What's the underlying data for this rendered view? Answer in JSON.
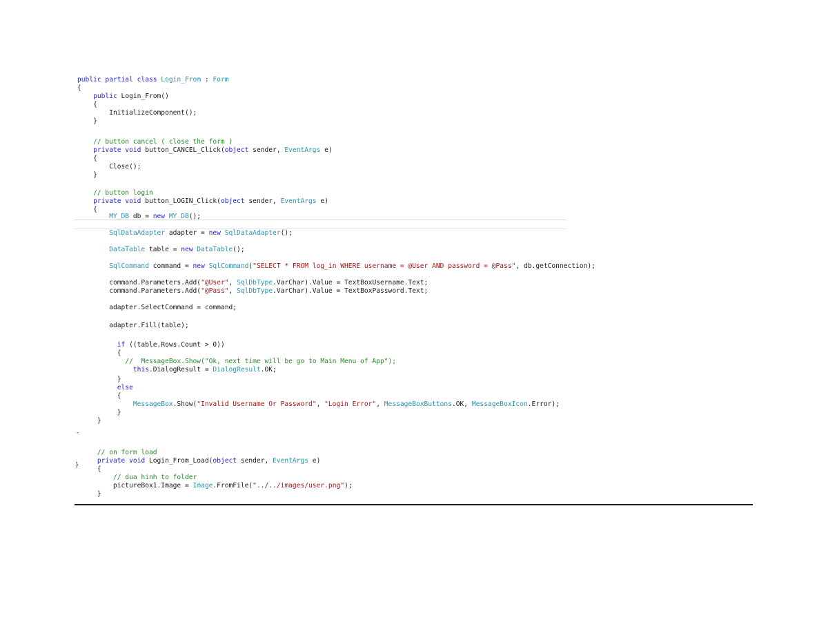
{
  "document": {
    "code_lines": [
      [
        {
          "t": "public partial class ",
          "c": "kw"
        },
        {
          "t": "Login_From",
          "c": "ty"
        },
        {
          "t": " : ",
          "c": "tx"
        },
        {
          "t": "Form",
          "c": "ty"
        }
      ],
      [
        {
          "t": "{",
          "c": "tx"
        }
      ],
      [
        {
          "t": "    public ",
          "c": "kw"
        },
        {
          "t": "Login_From()",
          "c": "tx"
        }
      ],
      [
        {
          "t": "    {",
          "c": "tx"
        }
      ],
      [
        {
          "t": "        InitializeComponent();",
          "c": "tx"
        }
      ],
      [
        {
          "t": "    }",
          "c": "tx"
        }
      ],
      [
        {
          "t": "",
          "c": "tx"
        }
      ],
      [
        {
          "t": "    // button cancel ( close the form )",
          "c": "cm"
        }
      ],
      [
        {
          "t": "    private void ",
          "c": "kw"
        },
        {
          "t": "button_CANCEL_Click(",
          "c": "tx"
        },
        {
          "t": "object",
          "c": "kw"
        },
        {
          "t": " sender, ",
          "c": "tx"
        },
        {
          "t": "EventArgs",
          "c": "ty"
        },
        {
          "t": " e)",
          "c": "tx"
        }
      ],
      [
        {
          "t": "    {",
          "c": "tx"
        }
      ],
      [
        {
          "t": "        Close();",
          "c": "tx"
        }
      ],
      [
        {
          "t": "    }",
          "c": "tx"
        }
      ],
      [
        {
          "t": "",
          "c": "tx"
        }
      ],
      [
        {
          "t": "    // button login",
          "c": "cm"
        }
      ],
      [
        {
          "t": "    private void ",
          "c": "kw"
        },
        {
          "t": "button_LOGIN_Click(",
          "c": "tx"
        },
        {
          "t": "object",
          "c": "kw"
        },
        {
          "t": " sender, ",
          "c": "tx"
        },
        {
          "t": "EventArgs",
          "c": "ty"
        },
        {
          "t": " e)",
          "c": "tx"
        }
      ],
      [
        {
          "t": "    {",
          "c": "tx"
        }
      ],
      [
        {
          "t": "        MY_DB",
          "c": "ty"
        },
        {
          "t": " db = ",
          "c": "tx"
        },
        {
          "t": "new ",
          "c": "kw"
        },
        {
          "t": "MY_DB",
          "c": "ty"
        },
        {
          "t": "();",
          "c": "tx"
        }
      ],
      [
        {
          "t": "",
          "c": "tx"
        }
      ],
      [
        {
          "t": "        SqlDataAdapter",
          "c": "ty"
        },
        {
          "t": " adapter = ",
          "c": "tx"
        },
        {
          "t": "new ",
          "c": "kw"
        },
        {
          "t": "SqlDataAdapter",
          "c": "ty"
        },
        {
          "t": "();",
          "c": "tx"
        }
      ],
      [
        {
          "t": "",
          "c": "tx"
        }
      ],
      [
        {
          "t": "        DataTable",
          "c": "ty"
        },
        {
          "t": " table = ",
          "c": "tx"
        },
        {
          "t": "new ",
          "c": "kw"
        },
        {
          "t": "DataTable",
          "c": "ty"
        },
        {
          "t": "();",
          "c": "tx"
        }
      ],
      [
        {
          "t": "",
          "c": "tx"
        }
      ],
      [
        {
          "t": "        SqlCommand",
          "c": "ty"
        },
        {
          "t": " command = ",
          "c": "tx"
        },
        {
          "t": "new ",
          "c": "kw"
        },
        {
          "t": "SqlCommand",
          "c": "ty"
        },
        {
          "t": "(",
          "c": "tx"
        },
        {
          "t": "\"SELECT * FROM log_in WHERE username = @User AND password = @Pass\"",
          "c": "st"
        },
        {
          "t": ", db.getConnection);",
          "c": "tx"
        }
      ],
      [
        {
          "t": "",
          "c": "tx"
        }
      ],
      [
        {
          "t": "        command.Parameters.Add(",
          "c": "tx"
        },
        {
          "t": "\"@User\"",
          "c": "st"
        },
        {
          "t": ", ",
          "c": "tx"
        },
        {
          "t": "SqlDbType",
          "c": "ty"
        },
        {
          "t": ".VarChar).Value = TextBoxUsername.Text;",
          "c": "tx"
        }
      ],
      [
        {
          "t": "        command.Parameters.Add(",
          "c": "tx"
        },
        {
          "t": "\"@Pass\"",
          "c": "st"
        },
        {
          "t": ", ",
          "c": "tx"
        },
        {
          "t": "SqlDbType",
          "c": "ty"
        },
        {
          "t": ".VarChar).Value = TextBoxPassword.Text;",
          "c": "tx"
        }
      ],
      [
        {
          "t": "",
          "c": "tx"
        }
      ],
      [
        {
          "t": "        adapter.SelectCommand = command;",
          "c": "tx"
        }
      ],
      [
        {
          "t": "",
          "c": "tx"
        }
      ],
      [
        {
          "t": "        adapter.Fill(table);",
          "c": "tx"
        }
      ],
      [
        {
          "t": "",
          "c": "tx"
        }
      ],
      [
        {
          "t": "",
          "c": "tx"
        }
      ],
      [
        {
          "t": "          if ",
          "c": "kw"
        },
        {
          "t": "((table.Rows.Count > 0))",
          "c": "tx"
        }
      ],
      [
        {
          "t": "          {",
          "c": "tx"
        }
      ],
      [
        {
          "t": "            //  MessageBox.Show(\"Ok, next time will be go to Main Menu of App\");",
          "c": "cm"
        }
      ],
      [
        {
          "t": "              this",
          "c": "kw"
        },
        {
          "t": ".DialogResult = ",
          "c": "tx"
        },
        {
          "t": "DialogResult",
          "c": "ty"
        },
        {
          "t": ".OK;",
          "c": "tx"
        }
      ],
      [
        {
          "t": "          }",
          "c": "tx"
        }
      ],
      [
        {
          "t": "          else",
          "c": "kw"
        }
      ],
      [
        {
          "t": "          {",
          "c": "tx"
        }
      ],
      [
        {
          "t": "              MessageBox",
          "c": "ty"
        },
        {
          "t": ".Show(",
          "c": "tx"
        },
        {
          "t": "\"Invalid Username Or Password\"",
          "c": "st"
        },
        {
          "t": ", ",
          "c": "tx"
        },
        {
          "t": "\"Login Error\"",
          "c": "st"
        },
        {
          "t": ", ",
          "c": "tx"
        },
        {
          "t": "MessageBoxButtons",
          "c": "ty"
        },
        {
          "t": ".OK, ",
          "c": "tx"
        },
        {
          "t": "MessageBoxIcon",
          "c": "ty"
        },
        {
          "t": ".Error);",
          "c": "tx"
        }
      ],
      [
        {
          "t": "          }",
          "c": "tx"
        }
      ],
      [
        {
          "t": "     }",
          "c": "tx"
        }
      ],
      [
        {
          "t": "",
          "c": "tx"
        }
      ],
      [
        {
          "t": "",
          "c": "tx"
        }
      ],
      [
        {
          "t": "     // on form load",
          "c": "cm"
        }
      ],
      [
        {
          "t": "     private void ",
          "c": "kw"
        },
        {
          "t": "Login_From_Load(",
          "c": "tx"
        },
        {
          "t": "object",
          "c": "kw"
        },
        {
          "t": " sender, ",
          "c": "tx"
        },
        {
          "t": "EventArgs",
          "c": "ty"
        },
        {
          "t": " e)",
          "c": "tx"
        }
      ],
      [
        {
          "t": "     {",
          "c": "tx"
        }
      ],
      [
        {
          "t": "         // dua hinh to folder",
          "c": "cm"
        }
      ],
      [
        {
          "t": "         pictureBox1.Image = ",
          "c": "tx"
        },
        {
          "t": "Image",
          "c": "ty"
        },
        {
          "t": ".FromFile(",
          "c": "tx"
        },
        {
          "t": "\"../../images/user.png\"",
          "c": "st"
        },
        {
          "t": ");",
          "c": "tx"
        }
      ],
      [
        {
          "t": "     }",
          "c": "tx"
        }
      ]
    ],
    "stray_glyphs": [
      "}",
      "-"
    ]
  }
}
